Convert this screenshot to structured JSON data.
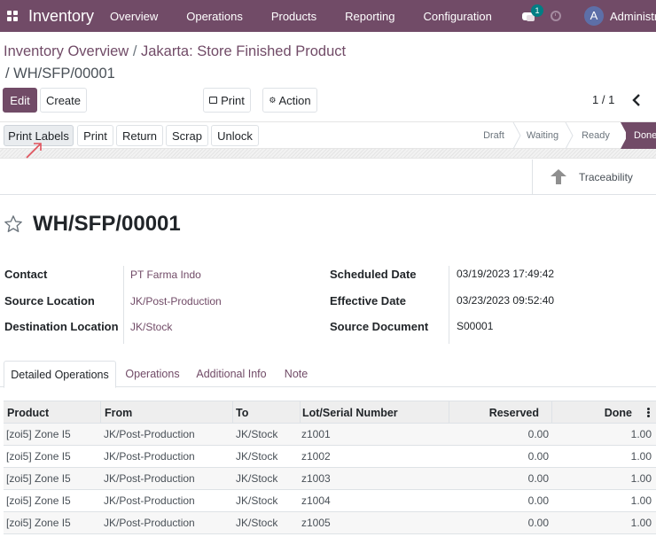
{
  "navbar": {
    "app_name": "Inventory",
    "menu": [
      "Overview",
      "Operations",
      "Products",
      "Reporting",
      "Configuration"
    ],
    "messages_count": "1",
    "user_initial": "A",
    "user_name": "Administrator"
  },
  "breadcrumb": {
    "parent": "Inventory Overview",
    "separator": "/",
    "middle": "Jakarta: Store Finished Product",
    "current": "/ WH/SFP/00001"
  },
  "controls": {
    "edit": "Edit",
    "create": "Create",
    "print": "Print",
    "action": "Action",
    "pager": "1 / 1"
  },
  "statusbar": {
    "buttons": [
      "Print Labels",
      "Print",
      "Return",
      "Scrap",
      "Unlock"
    ],
    "stages": [
      "Draft",
      "Waiting",
      "Ready",
      "Done"
    ],
    "current_stage": "Done"
  },
  "smart_buttons": {
    "traceability": "Traceability"
  },
  "record": {
    "title": "WH/SFP/00001",
    "fields": {
      "contact_label": "Contact",
      "contact": "PT Farma Indo",
      "source_location_label": "Source Location",
      "source_location": "JK/Post-Production",
      "destination_location_label": "Destination Location",
      "destination_location": "JK/Stock",
      "scheduled_date_label": "Scheduled Date",
      "scheduled_date": "03/19/2023 17:49:42",
      "effective_date_label": "Effective Date",
      "effective_date": "03/23/2023 09:52:40",
      "source_document_label": "Source Document",
      "source_document": "S00001"
    }
  },
  "tabs": [
    "Detailed Operations",
    "Operations",
    "Additional Info",
    "Note"
  ],
  "table": {
    "columns": [
      "Product",
      "From",
      "To",
      "Lot/Serial Number",
      "Reserved",
      "Done"
    ],
    "rows": [
      [
        "[zoi5] Zone I5",
        "JK/Post-Production",
        "JK/Stock",
        "z1001",
        "0.00",
        "1.00"
      ],
      [
        "[zoi5] Zone I5",
        "JK/Post-Production",
        "JK/Stock",
        "z1002",
        "0.00",
        "1.00"
      ],
      [
        "[zoi5] Zone I5",
        "JK/Post-Production",
        "JK/Stock",
        "z1003",
        "0.00",
        "1.00"
      ],
      [
        "[zoi5] Zone I5",
        "JK/Post-Production",
        "JK/Stock",
        "z1004",
        "0.00",
        "1.00"
      ],
      [
        "[zoi5] Zone I5",
        "JK/Post-Production",
        "JK/Stock",
        "z1005",
        "0.00",
        "1.00"
      ]
    ]
  },
  "colors": {
    "brand": "#714b67",
    "badge": "#017e84",
    "annotation_arrow": "#e0505a"
  }
}
